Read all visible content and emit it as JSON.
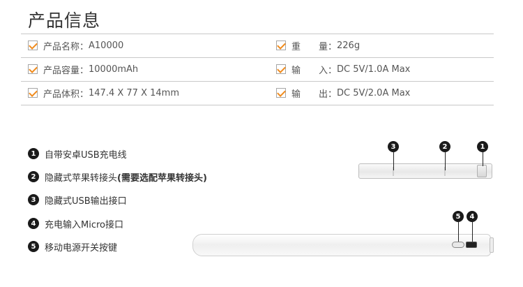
{
  "title": "产品信息",
  "specs": [
    {
      "label": "产品名称：",
      "value": "A10000",
      "label2": "重　　量：",
      "value2": "226g"
    },
    {
      "label": "产品容量：",
      "value": "10000mAh",
      "label2": "输　　入：",
      "value2": "DC 5V/1.0A Max"
    },
    {
      "label": "产品体积：",
      "value": "147.4 X 77 X 14mm",
      "label2": "输　　出：",
      "value2": "DC 5V/2.0A Max"
    }
  ],
  "features": [
    {
      "num": "1",
      "text": "自带安卓USB充电线"
    },
    {
      "num": "2",
      "text": "隐藏式苹果转接头",
      "note": "(需要选配苹果转接头)"
    },
    {
      "num": "3",
      "text": "隐藏式USB输出接口"
    },
    {
      "num": "4",
      "text": "充电输入Micro接口"
    },
    {
      "num": "5",
      "text": "移动电源开关按键"
    }
  ],
  "callouts_top": [
    "3",
    "2",
    "1"
  ],
  "callouts_bottom": [
    "5",
    "4"
  ],
  "colors": {
    "check": "#f08b1d",
    "badge": "#1a1a1a",
    "divider": "#c8c8c8"
  }
}
